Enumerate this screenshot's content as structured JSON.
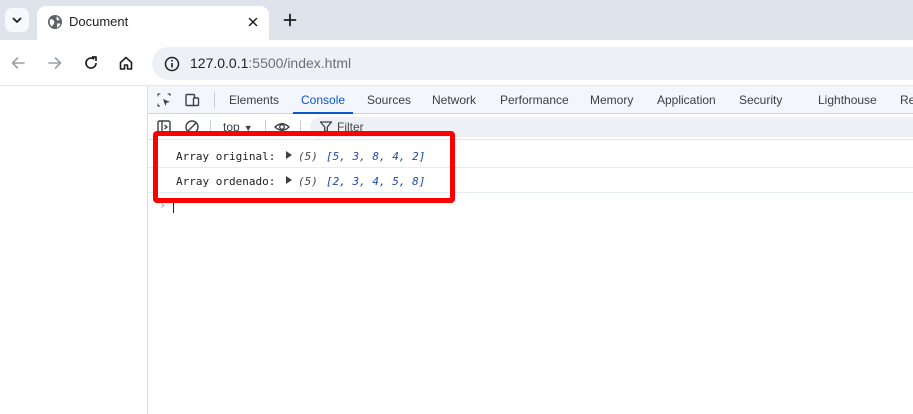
{
  "browser": {
    "tab": {
      "title": "Document"
    },
    "address": {
      "host": "127.0.0.1",
      "rest": ":5500/index.html"
    }
  },
  "devtools": {
    "tabs": [
      "Elements",
      "Console",
      "Sources",
      "Network",
      "Performance",
      "Memory",
      "Application",
      "Security",
      "Lighthouse",
      "Re"
    ],
    "active_tab": "Console",
    "console_toolbar": {
      "context": "top",
      "filter_placeholder": "Filter"
    },
    "logs": [
      {
        "label": "Array original:",
        "length": "(5)",
        "array": "[5, 3, 8, 4, 2]"
      },
      {
        "label": "Array ordenado:",
        "length": "(5)",
        "array": "[2, 3, 4, 5, 8]"
      }
    ],
    "prompt": "›"
  },
  "colors": {
    "accent": "#0b57d0",
    "highlight": "#ff0000",
    "array_value": "#1a49a8"
  }
}
